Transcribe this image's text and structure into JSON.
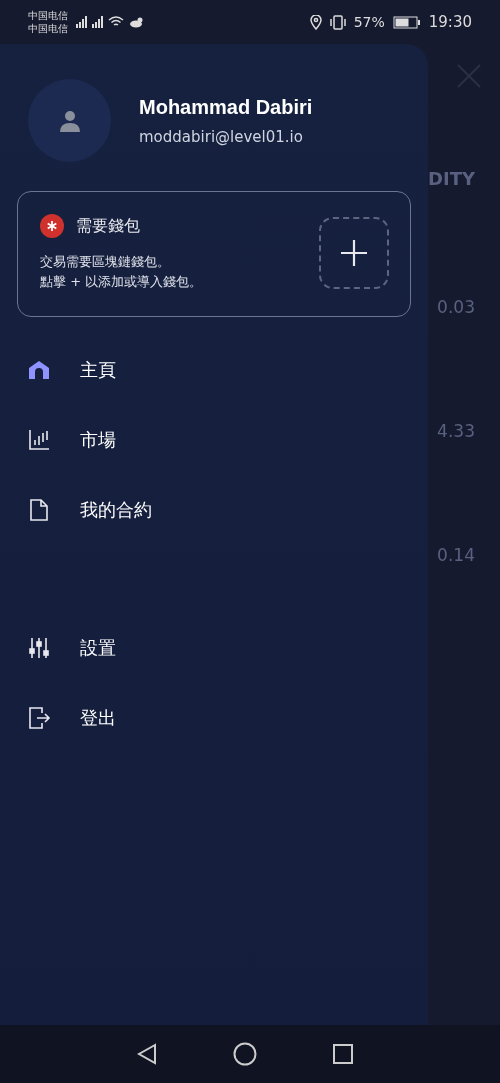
{
  "status_bar": {
    "carriers": [
      "中国电信",
      "中国电信"
    ],
    "battery": "57%",
    "time": "19:30"
  },
  "background": {
    "heading": "DITY",
    "values": [
      "0.03",
      "4.33",
      "0.14"
    ]
  },
  "drawer": {
    "user": {
      "name": "Mohammad Dabiri",
      "email": "moddabiri@level01.io"
    },
    "wallet_card": {
      "title": "需要錢包",
      "lines": [
        "交易需要區塊鏈錢包。",
        "點擊 + 以添加或導入錢包。"
      ]
    },
    "menu": [
      {
        "kind": "home",
        "label": "主頁",
        "selected": true
      },
      {
        "kind": "market",
        "label": "市場",
        "selected": false
      },
      {
        "kind": "contracts",
        "label": "我的合約",
        "selected": false
      }
    ],
    "menu_bottom": [
      {
        "kind": "settings",
        "label": "設置",
        "selected": false
      },
      {
        "kind": "logout",
        "label": "登出",
        "selected": false
      }
    ]
  }
}
